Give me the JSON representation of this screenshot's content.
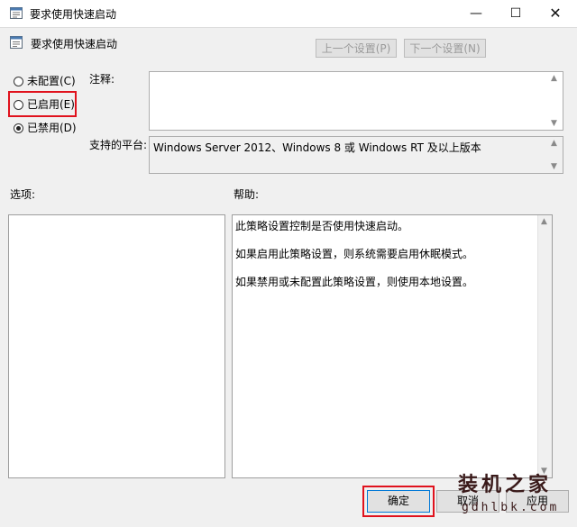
{
  "window": {
    "title": "要求使用快速启动",
    "minimize_glyph": "—",
    "maximize_glyph": "☐",
    "close_glyph": "✕"
  },
  "header": {
    "policy_name": "要求使用快速启动",
    "prev_button": "上一个设置(P)",
    "next_button": "下一个设置(N)"
  },
  "state_options": [
    {
      "label": "未配置(C)",
      "selected": false
    },
    {
      "label": "已启用(E)",
      "selected": false,
      "highlighted": true
    },
    {
      "label": "已禁用(D)",
      "selected": true
    }
  ],
  "comment": {
    "label": "注释:",
    "value": ""
  },
  "platform": {
    "label": "支持的平台:",
    "value": "Windows Server 2012、Windows 8 或 Windows RT 及以上版本"
  },
  "options_label": "选项:",
  "help": {
    "label": "帮助:",
    "paragraphs": [
      "此策略设置控制是否使用快速启动。",
      "如果启用此策略设置，则系统需要启用休眠模式。",
      "如果禁用或未配置此策略设置，则使用本地设置。"
    ]
  },
  "footer": {
    "ok": "确定",
    "cancel": "取消",
    "apply": "应用"
  },
  "icons": [
    "policy-icon",
    "minimize-icon",
    "maximize-icon",
    "close-icon",
    "scroll-up-icon",
    "scroll-down-icon"
  ],
  "colors": {
    "highlight_red": "#e0121d",
    "ok_border": "#0078d7"
  },
  "watermark": {
    "main": "装机之家",
    "sub": "gdhlbk.com"
  }
}
